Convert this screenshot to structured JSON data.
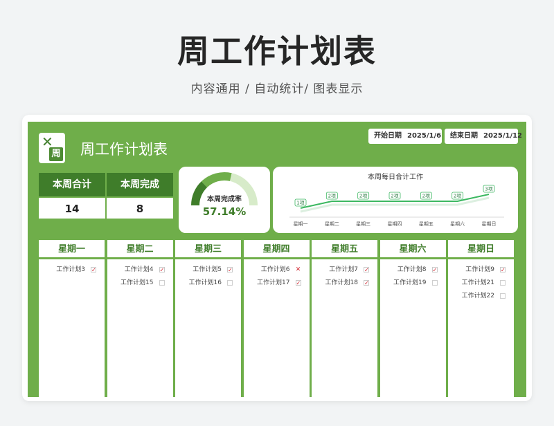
{
  "page": {
    "title": "周工作计划表",
    "subtitle": "内容通用 / 自动统计/ 图表显示"
  },
  "sheet": {
    "title": "周工作计划表",
    "logo_char": "周",
    "start_date_label": "开始日期",
    "start_date": "2025/1/6",
    "end_date_label": "结束日期",
    "end_date": "2025/1/12"
  },
  "stats": {
    "total_label": "本周合计",
    "total_value": "14",
    "done_label": "本周完成",
    "done_value": "8"
  },
  "gauge": {
    "label": "本周完成率",
    "value_text": "57.14%",
    "rate": 0.5714,
    "colors": {
      "done": "#3f7d2a",
      "mid": "#6fae4a",
      "rest": "#d7ebc9"
    }
  },
  "chart_data": {
    "type": "line",
    "title": "本周每日合计工作",
    "categories": [
      "星期一",
      "星期二",
      "星期三",
      "星期四",
      "星期五",
      "星期六",
      "星期日"
    ],
    "series": [
      {
        "values": [
          1,
          2,
          2,
          2,
          2,
          2,
          3
        ],
        "labels": [
          "1项",
          "2项",
          "2项",
          "2项",
          "2项",
          "2项",
          "3项"
        ]
      }
    ],
    "ylim": [
      0,
      4
    ],
    "grid": false,
    "line_color": "#3cb861"
  },
  "days": [
    {
      "name": "星期一",
      "tasks": [
        {
          "name": "工作计划3",
          "status": "done"
        }
      ]
    },
    {
      "name": "星期二",
      "tasks": [
        {
          "name": "工作计划4",
          "status": "done"
        },
        {
          "name": "工作计划15",
          "status": "empty"
        }
      ]
    },
    {
      "name": "星期三",
      "tasks": [
        {
          "name": "工作计划5",
          "status": "done"
        },
        {
          "name": "工作计划16",
          "status": "empty"
        }
      ]
    },
    {
      "name": "星期四",
      "tasks": [
        {
          "name": "工作计划6",
          "status": "fail"
        },
        {
          "name": "工作计划17",
          "status": "done"
        }
      ]
    },
    {
      "name": "星期五",
      "tasks": [
        {
          "name": "工作计划7",
          "status": "done"
        },
        {
          "name": "工作计划18",
          "status": "done"
        }
      ]
    },
    {
      "name": "星期六",
      "tasks": [
        {
          "name": "工作计划8",
          "status": "done"
        },
        {
          "name": "工作计划19",
          "status": "empty"
        }
      ]
    },
    {
      "name": "星期日",
      "tasks": [
        {
          "name": "工作计划9",
          "status": "done"
        },
        {
          "name": "工作计划21",
          "status": "empty"
        },
        {
          "name": "工作计划22",
          "status": "empty"
        }
      ]
    }
  ],
  "icons": {
    "done": "checked-box-icon",
    "empty": "empty-box-icon",
    "fail": "cross-icon",
    "tools": "tools-icon"
  }
}
